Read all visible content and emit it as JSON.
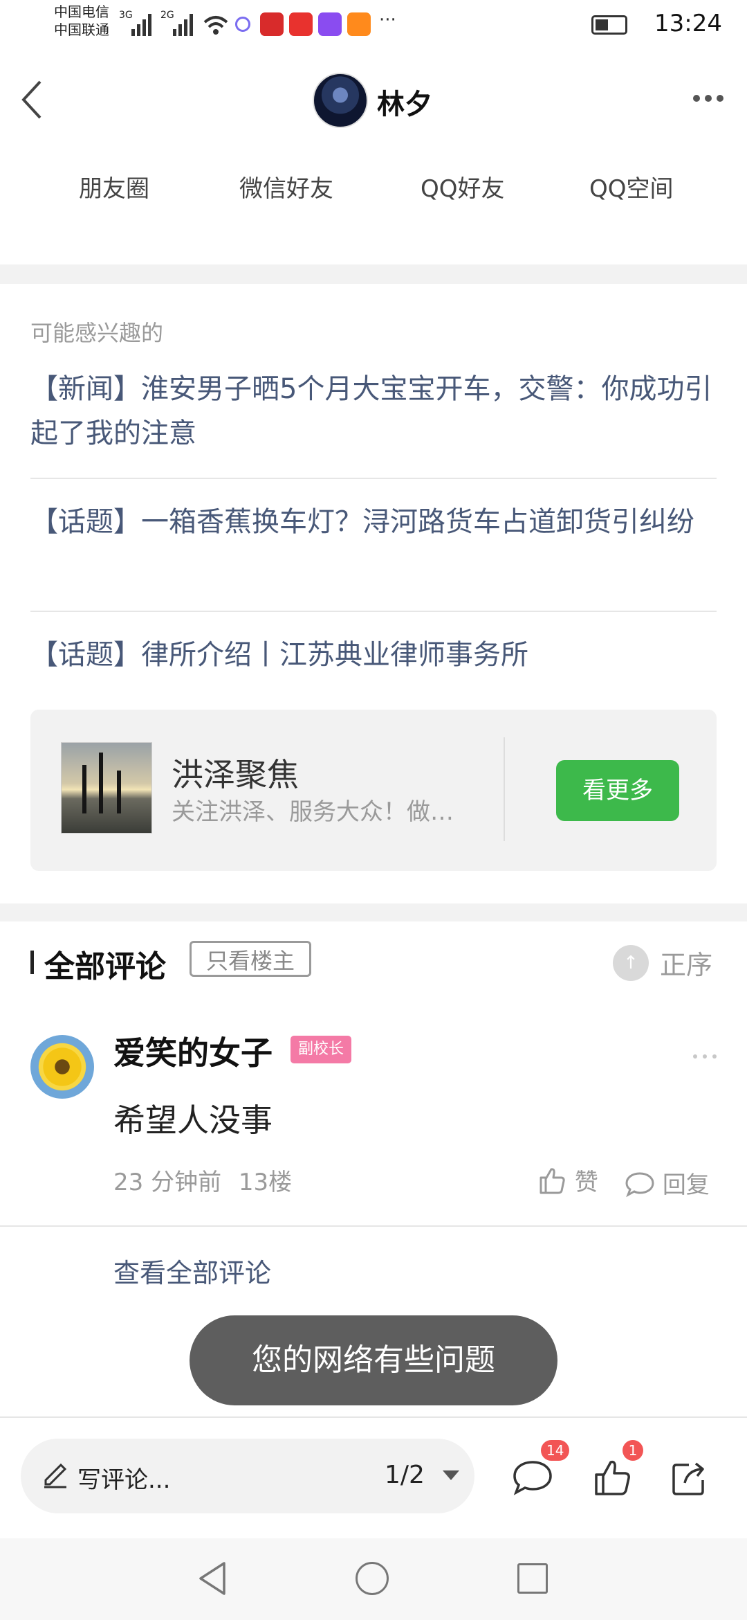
{
  "status_bar": {
    "carrier_1": "中国电信",
    "carrier_2": "中国联通",
    "net_1": "3G",
    "net_2": "2G",
    "more": "···",
    "time": "13:24"
  },
  "header": {
    "title": "林夕"
  },
  "share": {
    "items": [
      "朋友圈",
      "微信好友",
      "QQ好友",
      "QQ空间"
    ]
  },
  "recommend": {
    "label": "可能感兴趣的",
    "items": [
      "【新闻】淮安男子晒5个月大宝宝开车，交警：你成功引起了我的注意",
      "【话题】一箱香蕉换车灯？浔河路货车占道卸货引纠纷",
      "【话题】律所介绍丨江苏典业律师事务所"
    ]
  },
  "promo": {
    "name": "洪泽聚焦",
    "desc": "关注洪泽、服务大众！做…",
    "button": "看更多"
  },
  "comments": {
    "title": "全部评论",
    "filter": "只看楼主",
    "sort_label": "正序",
    "items": [
      {
        "user": "爱笑的女子",
        "badge": "副校长",
        "text": "希望人没事",
        "time": "23 分钟前",
        "floor": "13楼",
        "like_label": "赞",
        "reply_label": "回复"
      }
    ],
    "view_all": "查看全部评论"
  },
  "toast": "您的网络有些问题",
  "bottom_bar": {
    "placeholder": "写评论...",
    "page": "1/2",
    "comment_count": "14",
    "like_count": "1"
  },
  "colors": {
    "accent_green": "#3db94b",
    "link_blue": "#485878",
    "badge_red": "#f25555",
    "toast_bg": "#5e5e5e"
  }
}
